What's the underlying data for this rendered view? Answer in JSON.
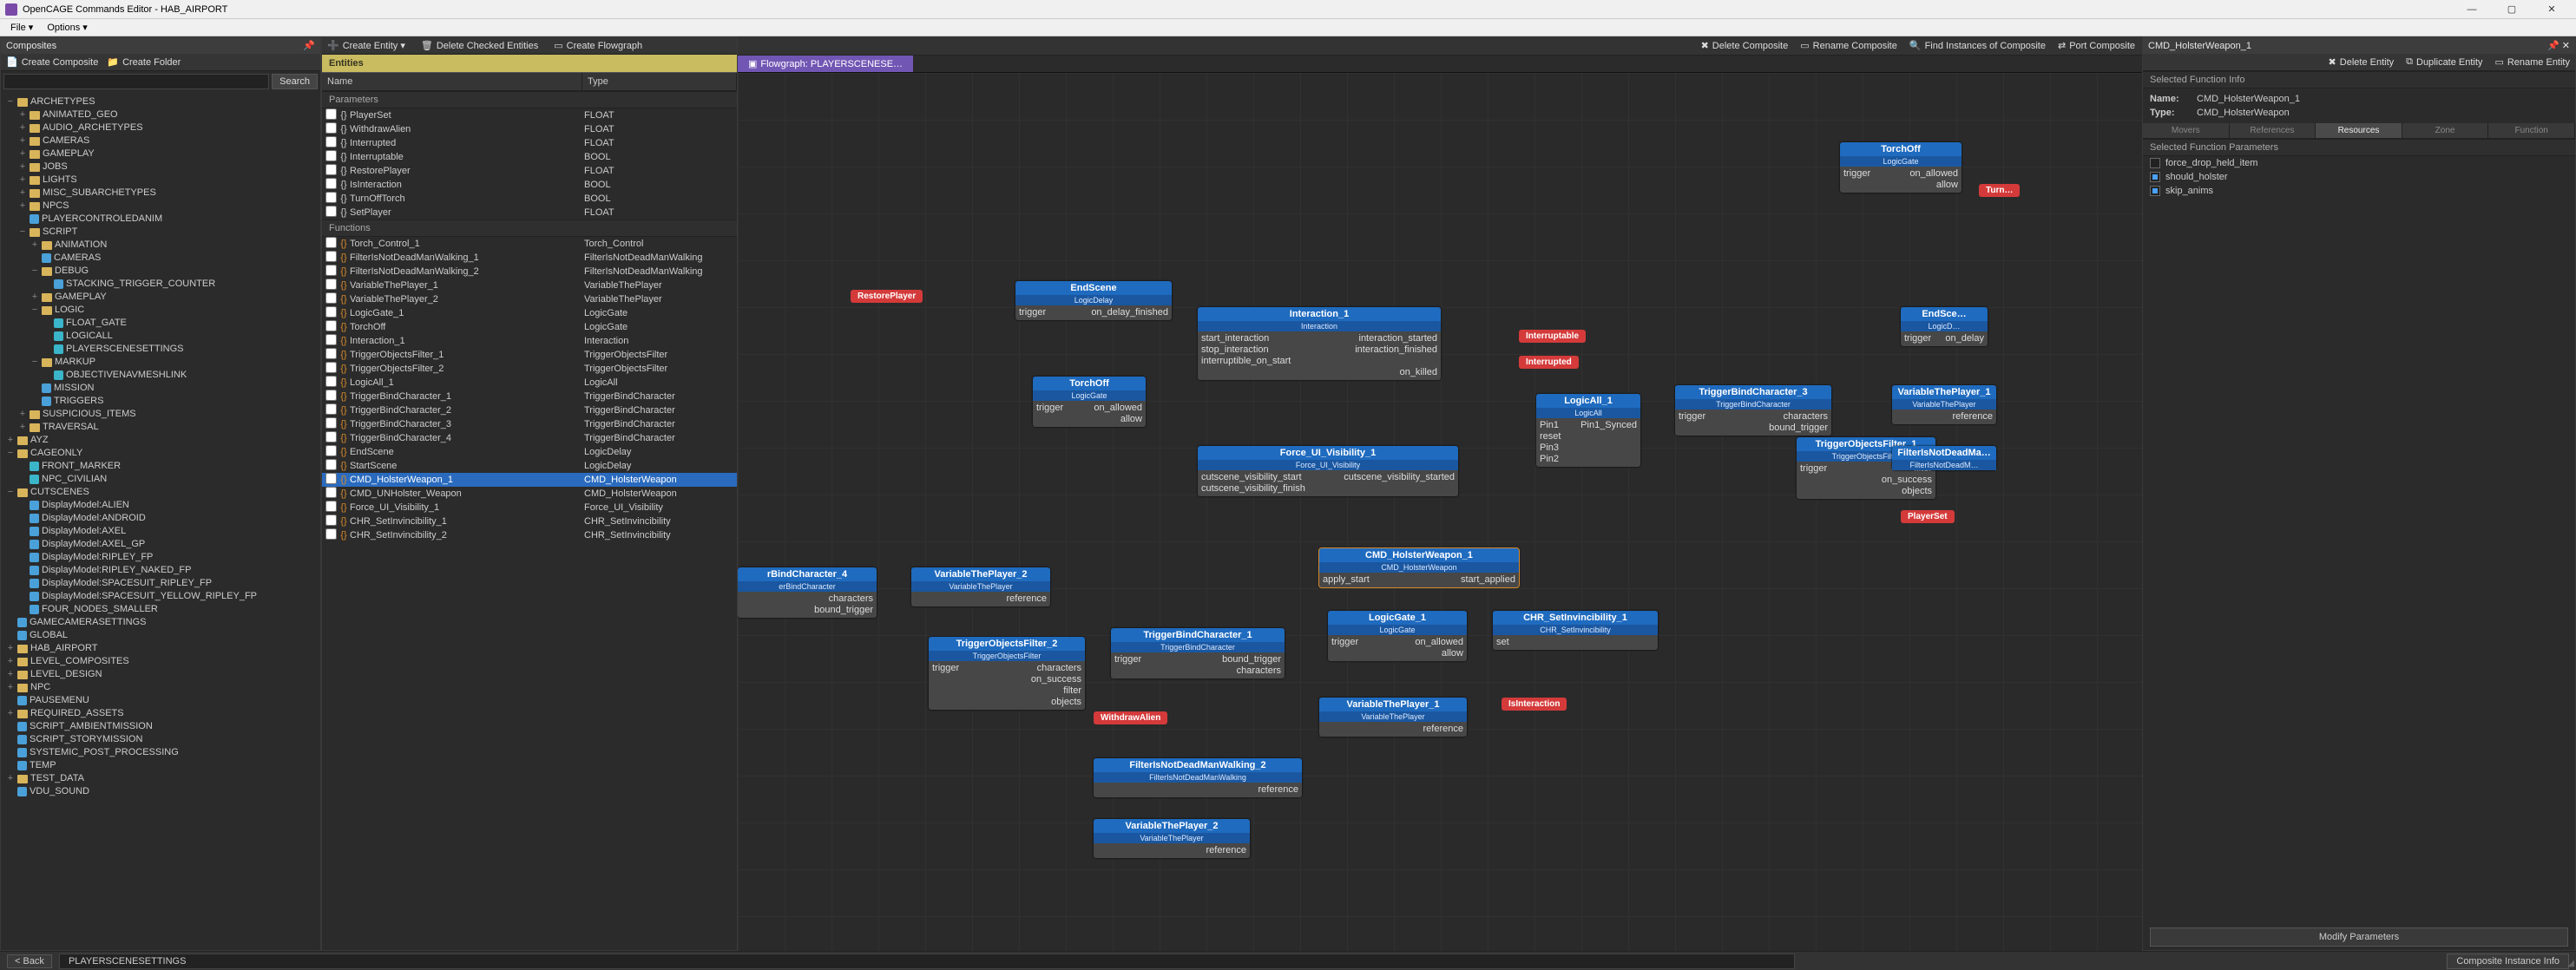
{
  "window": {
    "title": "OpenCAGE Commands Editor - HAB_AIRPORT",
    "minimize": "—",
    "maximize": "▢",
    "close": "✕"
  },
  "menu": {
    "file": "File ▾",
    "options": "Options ▾"
  },
  "composites": {
    "title": "Composites",
    "create_composite": "Create Composite",
    "create_folder": "Create Folder",
    "search_btn": "Search",
    "tree": [
      {
        "i": 0,
        "e": "−",
        "t": "ARCHETYPES",
        "ic": "folder"
      },
      {
        "i": 1,
        "e": "+",
        "t": "ANIMATED_GEO",
        "ic": "folder"
      },
      {
        "i": 1,
        "e": "+",
        "t": "AUDIO_ARCHETYPES",
        "ic": "folder"
      },
      {
        "i": 1,
        "e": "+",
        "t": "CAMERAS",
        "ic": "folder"
      },
      {
        "i": 1,
        "e": "+",
        "t": "GAMEPLAY",
        "ic": "folder"
      },
      {
        "i": 1,
        "e": "+",
        "t": "JOBS",
        "ic": "folder"
      },
      {
        "i": 1,
        "e": "+",
        "t": "LIGHTS",
        "ic": "folder"
      },
      {
        "i": 1,
        "e": "+",
        "t": "MISC_SUBARCHETYPES",
        "ic": "folder"
      },
      {
        "i": 1,
        "e": "+",
        "t": "NPCS",
        "ic": "folder"
      },
      {
        "i": 1,
        "e": "",
        "t": "PLAYERCONTROLEDANIM",
        "ic": "tag"
      },
      {
        "i": 1,
        "e": "−",
        "t": "SCRIPT",
        "ic": "folder"
      },
      {
        "i": 2,
        "e": "+",
        "t": "ANIMATION",
        "ic": "folder"
      },
      {
        "i": 2,
        "e": "",
        "t": "CAMERAS",
        "ic": "tag"
      },
      {
        "i": 2,
        "e": "−",
        "t": "DEBUG",
        "ic": "folder"
      },
      {
        "i": 3,
        "e": "",
        "t": "STACKING_TRIGGER_COUNTER",
        "ic": "tag"
      },
      {
        "i": 2,
        "e": "+",
        "t": "GAMEPLAY",
        "ic": "folder"
      },
      {
        "i": 2,
        "e": "−",
        "t": "LOGIC",
        "ic": "folder"
      },
      {
        "i": 3,
        "e": "",
        "t": "FLOAT_GATE",
        "ic": "cyan"
      },
      {
        "i": 3,
        "e": "",
        "t": "LOGICALL",
        "ic": "cyan"
      },
      {
        "i": 3,
        "e": "",
        "t": "PLAYERSCENESETTINGS",
        "ic": "cyan"
      },
      {
        "i": 2,
        "e": "−",
        "t": "MARKUP",
        "ic": "folder"
      },
      {
        "i": 3,
        "e": "",
        "t": "OBJECTIVENAVMESHLINK",
        "ic": "cyan"
      },
      {
        "i": 2,
        "e": "",
        "t": "MISSION",
        "ic": "tag"
      },
      {
        "i": 2,
        "e": "",
        "t": "TRIGGERS",
        "ic": "tag"
      },
      {
        "i": 1,
        "e": "+",
        "t": "SUSPICIOUS_ITEMS",
        "ic": "folder"
      },
      {
        "i": 1,
        "e": "+",
        "t": "TRAVERSAL",
        "ic": "folder"
      },
      {
        "i": 0,
        "e": "+",
        "t": "AYZ",
        "ic": "folder"
      },
      {
        "i": 0,
        "e": "−",
        "t": "CAGEONLY",
        "ic": "folder"
      },
      {
        "i": 1,
        "e": "",
        "t": "FRONT_MARKER",
        "ic": "cyan"
      },
      {
        "i": 1,
        "e": "",
        "t": "NPC_CIVILIAN",
        "ic": "cyan"
      },
      {
        "i": 0,
        "e": "−",
        "t": "CUTSCENES",
        "ic": "folder"
      },
      {
        "i": 1,
        "e": "",
        "t": "DisplayModel:ALIEN",
        "ic": "tag"
      },
      {
        "i": 1,
        "e": "",
        "t": "DisplayModel:ANDROID",
        "ic": "tag"
      },
      {
        "i": 1,
        "e": "",
        "t": "DisplayModel:AXEL",
        "ic": "tag"
      },
      {
        "i": 1,
        "e": "",
        "t": "DisplayModel:AXEL_GP",
        "ic": "tag"
      },
      {
        "i": 1,
        "e": "",
        "t": "DisplayModel:RIPLEY_FP",
        "ic": "tag"
      },
      {
        "i": 1,
        "e": "",
        "t": "DisplayModel:RIPLEY_NAKED_FP",
        "ic": "tag"
      },
      {
        "i": 1,
        "e": "",
        "t": "DisplayModel:SPACESUIT_RIPLEY_FP",
        "ic": "tag"
      },
      {
        "i": 1,
        "e": "",
        "t": "DisplayModel:SPACESUIT_YELLOW_RIPLEY_FP",
        "ic": "tag"
      },
      {
        "i": 1,
        "e": "",
        "t": "FOUR_NODES_SMALLER",
        "ic": "tag"
      },
      {
        "i": 0,
        "e": "",
        "t": "GAMECAMERASETTINGS",
        "ic": "tag"
      },
      {
        "i": 0,
        "e": "",
        "t": "GLOBAL",
        "ic": "tag"
      },
      {
        "i": 0,
        "e": "+",
        "t": "HAB_AIRPORT",
        "ic": "folder"
      },
      {
        "i": 0,
        "e": "+",
        "t": "LEVEL_COMPOSITES",
        "ic": "folder"
      },
      {
        "i": 0,
        "e": "+",
        "t": "LEVEL_DESIGN",
        "ic": "folder"
      },
      {
        "i": 0,
        "e": "+",
        "t": "NPC",
        "ic": "folder"
      },
      {
        "i": 0,
        "e": "",
        "t": "PAUSEMENU",
        "ic": "tag"
      },
      {
        "i": 0,
        "e": "+",
        "t": "REQUIRED_ASSETS",
        "ic": "folder"
      },
      {
        "i": 0,
        "e": "",
        "t": "SCRIPT_AMBIENTMISSION",
        "ic": "tag"
      },
      {
        "i": 0,
        "e": "",
        "t": "SCRIPT_STORYMISSION",
        "ic": "tag"
      },
      {
        "i": 0,
        "e": "",
        "t": "SYSTEMIC_POST_PROCESSING",
        "ic": "tag"
      },
      {
        "i": 0,
        "e": "",
        "t": "TEMP",
        "ic": "tag"
      },
      {
        "i": 0,
        "e": "+",
        "t": "TEST_DATA",
        "ic": "folder"
      },
      {
        "i": 0,
        "e": "",
        "t": "VDU_SOUND",
        "ic": "tag"
      }
    ]
  },
  "entities_toolbar": {
    "create_entity": "Create Entity ▾",
    "delete_checked": "Delete Checked Entities",
    "create_flowgraph": "Create Flowgraph"
  },
  "entities_panel": {
    "header": "Entities",
    "columns": {
      "name": "Name",
      "type": "Type"
    },
    "parameters_label": "Parameters",
    "functions_label": "Functions",
    "parameters": [
      {
        "n": "PlayerSet",
        "t": "FLOAT"
      },
      {
        "n": "WithdrawAlien",
        "t": "FLOAT"
      },
      {
        "n": "Interrupted",
        "t": "FLOAT"
      },
      {
        "n": "Interruptable",
        "t": "BOOL"
      },
      {
        "n": "RestorePlayer",
        "t": "FLOAT"
      },
      {
        "n": "IsInteraction",
        "t": "BOOL"
      },
      {
        "n": "TurnOffTorch",
        "t": "BOOL"
      },
      {
        "n": "SetPlayer",
        "t": "FLOAT"
      }
    ],
    "functions": [
      {
        "n": "Torch_Control_1",
        "t": "Torch_Control"
      },
      {
        "n": "FilterIsNotDeadManWalking_1",
        "t": "FilterIsNotDeadManWalking"
      },
      {
        "n": "FilterIsNotDeadManWalking_2",
        "t": "FilterIsNotDeadManWalking"
      },
      {
        "n": "VariableThePlayer_1",
        "t": "VariableThePlayer"
      },
      {
        "n": "VariableThePlayer_2",
        "t": "VariableThePlayer"
      },
      {
        "n": "LogicGate_1",
        "t": "LogicGate"
      },
      {
        "n": "TorchOff",
        "t": "LogicGate"
      },
      {
        "n": "Interaction_1",
        "t": "Interaction"
      },
      {
        "n": "TriggerObjectsFilter_1",
        "t": "TriggerObjectsFilter"
      },
      {
        "n": "TriggerObjectsFilter_2",
        "t": "TriggerObjectsFilter"
      },
      {
        "n": "LogicAll_1",
        "t": "LogicAll"
      },
      {
        "n": "TriggerBindCharacter_1",
        "t": "TriggerBindCharacter"
      },
      {
        "n": "TriggerBindCharacter_2",
        "t": "TriggerBindCharacter"
      },
      {
        "n": "TriggerBindCharacter_3",
        "t": "TriggerBindCharacter"
      },
      {
        "n": "TriggerBindCharacter_4",
        "t": "TriggerBindCharacter"
      },
      {
        "n": "EndScene",
        "t": "LogicDelay"
      },
      {
        "n": "StartScene",
        "t": "LogicDelay"
      },
      {
        "n": "CMD_HolsterWeapon_1",
        "t": "CMD_HolsterWeapon",
        "sel": true
      },
      {
        "n": "CMD_UNHolster_Weapon",
        "t": "CMD_HolsterWeapon"
      },
      {
        "n": "Force_UI_Visibility_1",
        "t": "Force_UI_Visibility"
      },
      {
        "n": "CHR_SetInvincibility_1",
        "t": "CHR_SetInvincibility"
      },
      {
        "n": "CHR_SetInvincibility_2",
        "t": "CHR_SetInvincibility"
      }
    ]
  },
  "canvas_toolbar": {
    "delete_composite": "Delete Composite",
    "rename_composite": "Rename Composite",
    "find_instances": "Find Instances of Composite",
    "port_composite": "Port Composite"
  },
  "tab": "Flowgraph: PLAYERSCENESE…",
  "right": {
    "header": "CMD_HolsterWeapon_1",
    "toolbar": {
      "delete": "Delete Entity",
      "duplicate": "Duplicate Entity",
      "rename": "Rename Entity"
    },
    "info_label": "Selected Function Info",
    "name_k": "Name:",
    "name_v": "CMD_HolsterWeapon_1",
    "type_k": "Type:",
    "type_v": "CMD_HolsterWeapon",
    "tabs": {
      "movers": "Movers",
      "references": "References",
      "resources": "Resources",
      "zone": "Zone",
      "function": "Function"
    },
    "params_label": "Selected Function Parameters",
    "params": [
      {
        "k": "force_drop_held_item",
        "on": false
      },
      {
        "k": "should_holster",
        "on": true
      },
      {
        "k": "skip_anims",
        "on": true
      }
    ],
    "modify_btn": "Modify Parameters"
  },
  "status": {
    "back": "< Back",
    "crumb": "PLAYERSCENESETTINGS",
    "right": "Composite Instance Info"
  },
  "nodes": {
    "restorePlayer": "RestorePlayer",
    "endScene": {
      "t": "EndScene",
      "s": "LogicDelay",
      "in": "trigger",
      "out": "on_delay_finished"
    },
    "torchOff": {
      "t": "TorchOff",
      "s": "LogicGate",
      "r1l": "trigger",
      "r1r": "on_allowed",
      "r2r": "allow"
    },
    "interaction": {
      "t": "Interaction_1",
      "s": "Interaction",
      "rows": [
        [
          "start_interaction",
          "interaction_started"
        ],
        [
          "stop_interaction",
          "interaction_finished"
        ],
        [
          "interruptible_on_start",
          ""
        ],
        [
          "",
          "on_killed"
        ]
      ]
    },
    "interruptable": "Interruptable",
    "interrupted": "Interrupted",
    "forceUI": {
      "t": "Force_UI_Visibility_1",
      "s": "Force_UI_Visibility",
      "rows": [
        [
          "cutscene_visibility_start",
          "cutscene_visibility_started"
        ],
        [
          "cutscene_visibility_finish",
          ""
        ]
      ]
    },
    "logicAll": {
      "t": "LogicAll_1",
      "s": "LogicAll",
      "rows": [
        [
          "Pin1",
          "Pin1_Synced"
        ],
        [
          "reset",
          ""
        ],
        [
          "Pin3",
          ""
        ],
        [
          "Pin2",
          ""
        ]
      ]
    },
    "tbChar3": {
      "t": "TriggerBindCharacter_3",
      "s": "TriggerBindCharacter",
      "rows": [
        [
          "trigger",
          "characters"
        ],
        [
          "",
          "bound_trigger"
        ]
      ]
    },
    "toFilter1": {
      "t": "TriggerObjectsFilter_1",
      "s": "TriggerObjectsFilter",
      "rows": [
        [
          "trigger",
          "filter"
        ],
        [
          "",
          "on_success"
        ],
        [
          "",
          "objects"
        ]
      ]
    },
    "varPlayerR": {
      "t": "VariableThePlayer_1",
      "s": "VariableThePlayer",
      "rows": [
        [
          "",
          "reference"
        ]
      ]
    },
    "filterR": {
      "t": "FilterIsNotDeadMa…",
      "s": "FilterIsNotDeadM…"
    },
    "playerSet": "PlayerSet",
    "endSceneR": {
      "t": "EndSce…",
      "s": "LogicD…",
      "rows": [
        [
          "trigger",
          "on_delay"
        ]
      ]
    },
    "torchOffTop": {
      "t": "TorchOff",
      "s": "LogicGate",
      "rows": [
        [
          "trigger",
          "on_allowed"
        ],
        [
          "",
          "allow"
        ]
      ]
    },
    "tbChar4": {
      "t": "rBindCharacter_4",
      "s": "erBindCharacter",
      "rows": [
        [
          "",
          "characters"
        ],
        [
          "",
          "bound_trigger"
        ]
      ]
    },
    "varPlayer2": {
      "t": "VariableThePlayer_2",
      "s": "VariableThePlayer",
      "rows": [
        [
          "",
          "reference"
        ]
      ]
    },
    "toFilter2": {
      "t": "TriggerObjectsFilter_2",
      "s": "TriggerObjectsFilter",
      "rows": [
        [
          "trigger",
          "characters"
        ],
        [
          "",
          "on_success"
        ],
        [
          "",
          "filter"
        ],
        [
          "",
          "objects"
        ]
      ]
    },
    "tbChar1": {
      "t": "TriggerBindCharacter_1",
      "s": "TriggerBindCharacter",
      "rows": [
        [
          "trigger",
          "bound_trigger"
        ],
        [
          "",
          "characters"
        ]
      ]
    },
    "cmdHolster": {
      "t": "CMD_HolsterWeapon_1",
      "s": "CMD_HolsterWeapon",
      "rows": [
        [
          "apply_start",
          "start_applied"
        ]
      ]
    },
    "logicGate1": {
      "t": "LogicGate_1",
      "s": "LogicGate",
      "rows": [
        [
          "trigger",
          "on_allowed"
        ],
        [
          "",
          "allow"
        ]
      ]
    },
    "chrInv": {
      "t": "CHR_SetInvincibility_1",
      "s": "CHR_SetInvincibility",
      "rows": [
        [
          "set",
          ""
        ]
      ]
    },
    "isInteraction": "IsInteraction",
    "varPlayer1": {
      "t": "VariableThePlayer_1",
      "s": "VariableThePlayer",
      "rows": [
        [
          "",
          "reference"
        ]
      ]
    },
    "withdrawAlien": "WithdrawAlien",
    "filter2": {
      "t": "FilterIsNotDeadManWalking_2",
      "s": "FilterIsNotDeadManWalking",
      "rows": [
        [
          "",
          "reference"
        ]
      ]
    },
    "varPlayer2b": {
      "t": "VariableThePlayer_2",
      "s": "VariableThePlayer",
      "rows": [
        [
          "",
          "reference"
        ]
      ]
    },
    "turnR": "Turn…"
  }
}
